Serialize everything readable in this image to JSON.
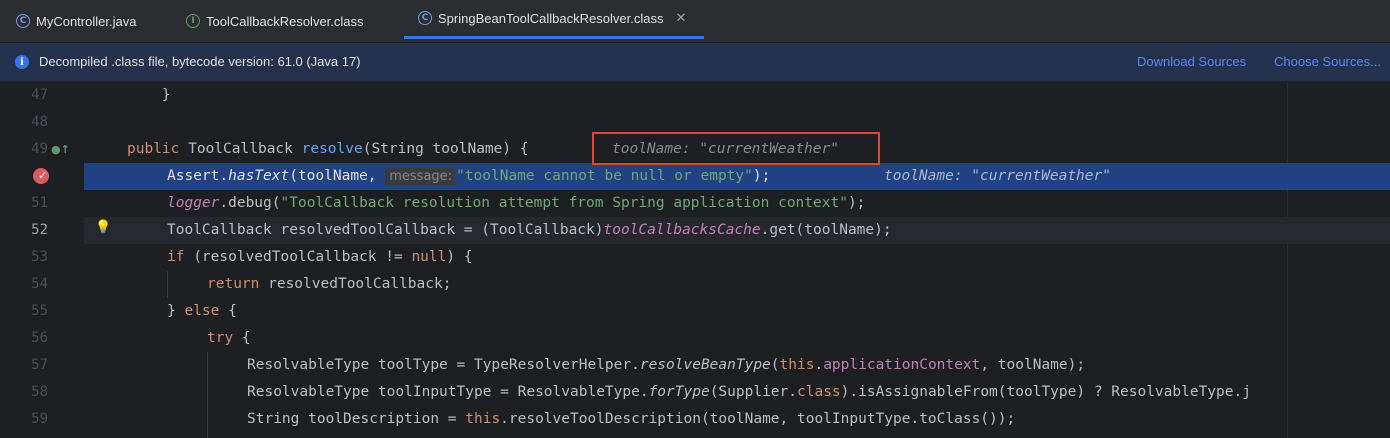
{
  "tabs": [
    {
      "label": "MyController.java",
      "icon": "class-icon"
    },
    {
      "label": "ToolCallbackResolver.class",
      "icon": "interface-icon"
    },
    {
      "label": "SpringBeanToolCallbackResolver.class",
      "icon": "class-icon",
      "active": true
    }
  ],
  "banner": {
    "text": "Decompiled .class file, bytecode version: 61.0 (Java 17)",
    "download": "Download Sources",
    "choose": "Choose Sources..."
  },
  "lines": [
    {
      "num": "47"
    },
    {
      "num": "48"
    },
    {
      "num": "49"
    },
    {
      "num": ""
    },
    {
      "num": "51"
    },
    {
      "num": "52"
    },
    {
      "num": "53"
    },
    {
      "num": "54"
    },
    {
      "num": "55"
    },
    {
      "num": "56"
    },
    {
      "num": "57"
    },
    {
      "num": "58"
    },
    {
      "num": "59"
    }
  ],
  "code": {
    "l47": "    }",
    "l49_a": "    public ToolCallback ",
    "l49_fn": "resolve",
    "l49_b": "(String toolName) {",
    "l49_hint": "toolName: \"currentWeather\"",
    "l50_a": "        Assert.",
    "l50_m": "hasText",
    "l50_b": "(toolName, ",
    "l50_label": "message:",
    "l50_str": "\"toolName cannot be null or empty\"",
    "l50_c": ");",
    "l50_hint": "toolName: \"currentWeather\"",
    "l51_lg": "logger",
    "l51_b": ".debug(",
    "l51_str": "\"ToolCallback resolution attempt from Spring application context\"",
    "l51_c": ");",
    "l52_a": "        ToolCallback resolvedToolCallback = (ToolCallback)",
    "l52_f": "toolCallbacksCache",
    "l52_b": ".get(toolName);",
    "l53_kw": "if",
    "l53_b": " (resolvedToolCallback != ",
    "l53_null": "null",
    "l53_c": ") {",
    "l54_kw": "return",
    "l54_b": " resolvedToolCallback;",
    "l55_a": "        } ",
    "l55_kw": "else",
    "l55_b": " {",
    "l56_kw": "try",
    "l56_b": " {",
    "l57_a": "                ResolvableType toolType = TypeResolverHelper.",
    "l57_m": "resolveBeanType",
    "l57_b": "(",
    "l57_this": "this",
    "l57_dot": ".",
    "l57_f": "applicationContext",
    "l57_c": ", toolName);",
    "l58_a": "                ResolvableType toolInputType = ResolvableType.",
    "l58_m": "forType",
    "l58_b": "(Supplier.",
    "l58_kw": "class",
    "l58_c": ").isAssignableFrom(toolType) ? ResolvableType.j",
    "l59_a": "                String toolDescription = ",
    "l59_this": "this",
    "l59_b": ".resolveToolDescription(toolName, toolInputType.toClass());"
  }
}
